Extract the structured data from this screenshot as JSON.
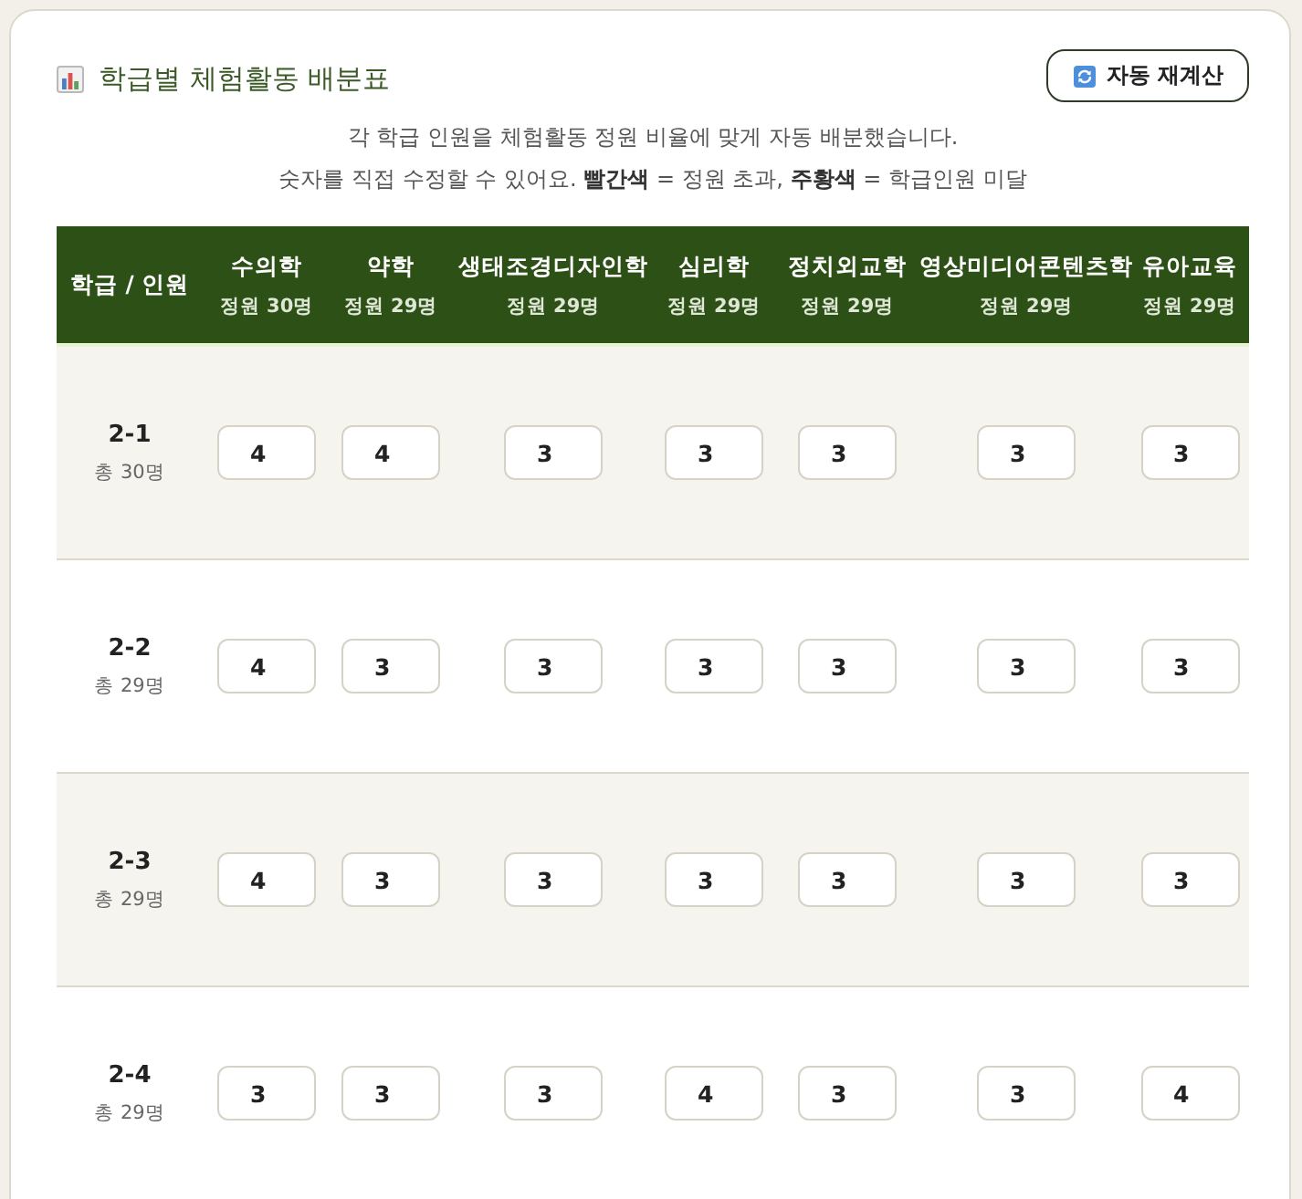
{
  "title": "학급별 체험활동 배분표",
  "recalc_button": {
    "label": "자동 재계산"
  },
  "description": [
    "각 학급 인원을 체험활동 정원 비율에 맞게 자동 배분했습니다.",
    "숫자를 직접 수정할 수 있어요. **빨간색** = 정원 초과, **주황색** = 학급인원 미달"
  ],
  "table": {
    "corner_header": "학급 / 인원",
    "columns": [
      {
        "name": "수의학",
        "capacity": "정원 30명"
      },
      {
        "name": "약학",
        "capacity": "정원 29명"
      },
      {
        "name": "생태조경디자인학",
        "capacity": "정원 29명"
      },
      {
        "name": "심리학",
        "capacity": "정원 29명"
      },
      {
        "name": "정치외교학",
        "capacity": "정원 29명"
      },
      {
        "name": "영상미디어콘텐츠학",
        "capacity": "정원 29명"
      },
      {
        "name": "유아교육",
        "capacity": "정원 29명"
      }
    ],
    "rows": [
      {
        "class": "2-1",
        "total": "총 30명",
        "values": [
          "4",
          "4",
          "3",
          "3",
          "3",
          "3",
          "3"
        ]
      },
      {
        "class": "2-2",
        "total": "총 29명",
        "values": [
          "4",
          "3",
          "3",
          "3",
          "3",
          "3",
          "3"
        ]
      },
      {
        "class": "2-3",
        "total": "총 29명",
        "values": [
          "4",
          "3",
          "3",
          "3",
          "3",
          "3",
          "3"
        ]
      },
      {
        "class": "2-4",
        "total": "총 29명",
        "values": [
          "3",
          "3",
          "3",
          "4",
          "3",
          "3",
          "4"
        ]
      }
    ]
  }
}
